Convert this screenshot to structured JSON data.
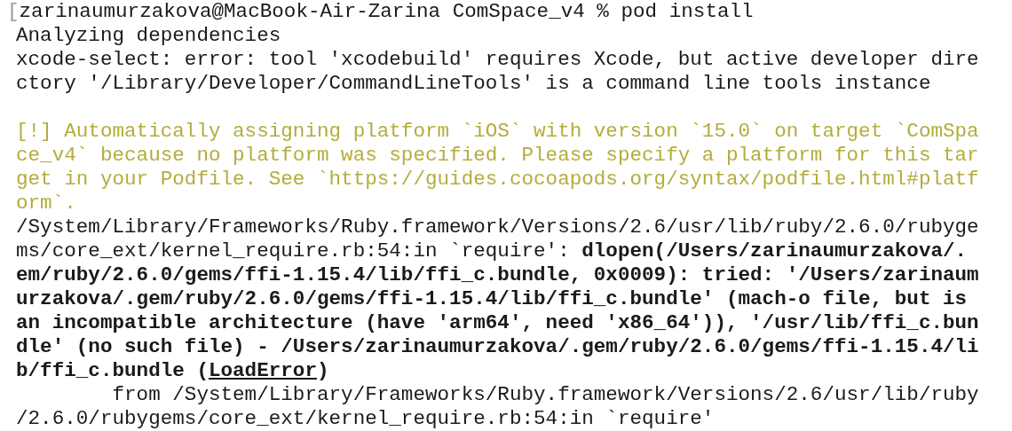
{
  "terminal": {
    "lines": [
      {
        "kind": "normal",
        "segments": [
          {
            "text": "[",
            "muted": true
          },
          {
            "text": "zarinaumurzakova@MacBook-Air-Zarina ComSpace_v4 % pod install"
          }
        ]
      },
      {
        "kind": "normal",
        "segments": [
          {
            "text": "Analyzing dependencies"
          }
        ]
      },
      {
        "kind": "normal",
        "segments": [
          {
            "text": "xcode-select: error: tool 'xcodebuild' requires Xcode, but active developer dire"
          }
        ]
      },
      {
        "kind": "normal",
        "segments": [
          {
            "text": "ctory '/Library/Developer/CommandLineTools' is a command line tools instance"
          }
        ]
      },
      {
        "kind": "blank"
      },
      {
        "kind": "warning",
        "segments": [
          {
            "text": "[!] Automatically assigning platform `iOS` with version `15.0` on target `ComSpa"
          }
        ]
      },
      {
        "kind": "warning",
        "segments": [
          {
            "text": "ce_v4` because no platform was specified. Please specify a platform for this tar"
          }
        ]
      },
      {
        "kind": "warning",
        "segments": [
          {
            "text": "get in your Podfile. See `https://guides.cocoapods.org/syntax/podfile.html#platf"
          }
        ]
      },
      {
        "kind": "warning",
        "segments": [
          {
            "text": "orm`."
          }
        ]
      },
      {
        "kind": "normal",
        "segments": [
          {
            "text": "/System/Library/Frameworks/Ruby.framework/Versions/2.6/usr/lib/ruby/2.6.0/rubyge"
          }
        ]
      },
      {
        "kind": "normal",
        "segments": [
          {
            "text": "ms/core_ext/kernel_require.rb:54:in `require': "
          },
          {
            "text": "dlopen(/Users/zarinaumurzakova/.",
            "bold": true
          }
        ]
      },
      {
        "kind": "normal",
        "segments": [
          {
            "text": "em/ruby/2.6.0/gems/ffi-1.15.4/lib/ffi_c.bundle, 0x0009): tried: '/Users/zarinaum",
            "bold": true
          }
        ]
      },
      {
        "kind": "normal",
        "segments": [
          {
            "text": "urzakova/.gem/ruby/2.6.0/gems/ffi-1.15.4/lib/ffi_c.bundle' (mach-o file, but is",
            "bold": true
          }
        ]
      },
      {
        "kind": "normal",
        "segments": [
          {
            "text": "an incompatible architecture (have 'arm64', need 'x86_64')), '/usr/lib/ffi_c.bun",
            "bold": true
          }
        ]
      },
      {
        "kind": "normal",
        "segments": [
          {
            "text": "dle' (no such file) - /Users/zarinaumurzakova/.gem/ruby/2.6.0/gems/ffi-1.15.4/li",
            "bold": true
          }
        ]
      },
      {
        "kind": "normal",
        "segments": [
          {
            "text": "b/ffi_c.bundle (",
            "bold": true
          },
          {
            "text": "LoadError",
            "bold": true,
            "underline": true
          },
          {
            "text": ")",
            "bold": true
          }
        ]
      },
      {
        "kind": "normal",
        "segments": [
          {
            "text": "        from /System/Library/Frameworks/Ruby.framework/Versions/2.6/usr/lib/ruby"
          }
        ]
      },
      {
        "kind": "normal",
        "segments": [
          {
            "text": "/2.6.0/rubygems/core_ext/kernel_require.rb:54:in `require'"
          }
        ]
      }
    ]
  }
}
